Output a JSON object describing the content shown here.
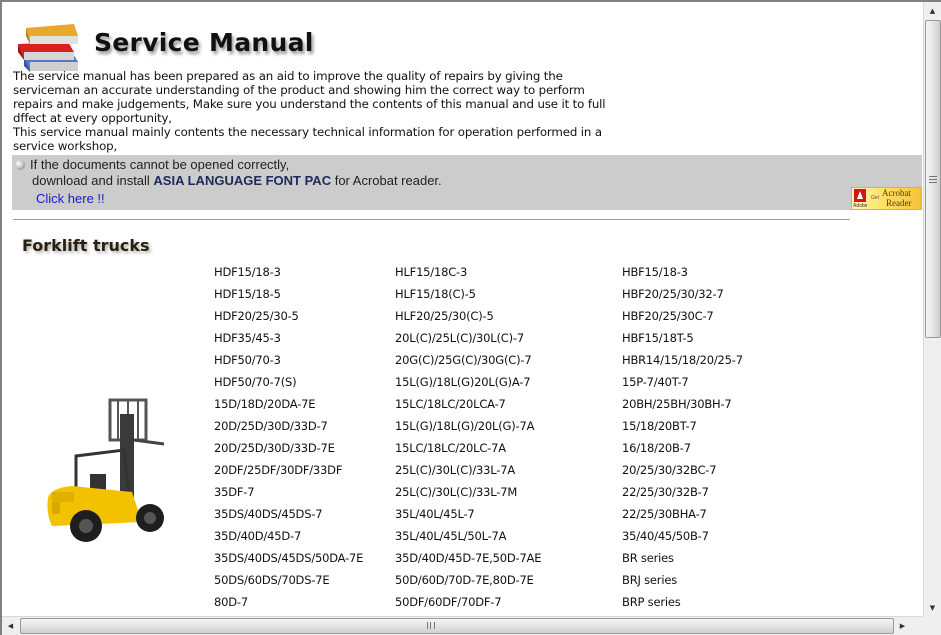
{
  "header": {
    "title": "Service Manual",
    "logo_icon": "books-icon"
  },
  "intro": {
    "paragraph1": "The service manual has been prepared as an aid to improve the quality of repairs by giving the serviceman an accurate understanding of the product and showing him the correct way to perform repairs and make judgements, Make sure you understand the contents of this manual and use it to full dffect at every opportunity,",
    "paragraph2": "This service manual mainly contents the necessary technical information for operation performed in a service workshop,"
  },
  "notice": {
    "line1": "If the documents cannot be opened correctly,",
    "line2_prefix": "download and install ",
    "line2_bold": "ASIA LANGUAGE FONT PAC",
    "line2_suffix": " for Acrobat reader.",
    "link": "Click here !!",
    "badge": {
      "adobe": "Adobe",
      "get": "Get",
      "acrobat": "Acrobat",
      "reader": "Reader"
    }
  },
  "section": {
    "title": "Forklift trucks",
    "image": "forklift-image"
  },
  "models": {
    "column1": [
      "HDF15/18-3",
      "HDF15/18-5",
      "HDF20/25/30-5",
      "HDF35/45-3",
      "HDF50/70-3",
      "HDF50/70-7(S)",
      "15D/18D/20DA-7E",
      "20D/25D/30D/33D-7",
      "20D/25D/30D/33D-7E",
      "20DF/25DF/30DF/33DF",
      "35DF-7",
      "35DS/40DS/45DS-7",
      "35D/40D/45D-7",
      "35DS/40DS/45DS/50DA-7E",
      "50DS/60DS/70DS-7E",
      "80D-7"
    ],
    "column2": [
      "HLF15/18C-3",
      "HLF15/18(C)-5",
      "HLF20/25/30(C)-5",
      "20L(C)/25L(C)/30L(C)-7",
      "20G(C)/25G(C)/30G(C)-7",
      "15L(G)/18L(G)20L(G)A-7",
      "15LC/18LC/20LCA-7",
      "15L(G)/18L(G)/20L(G)-7A",
      "15LC/18LC/20LC-7A",
      "25L(C)/30L(C)/33L-7A",
      "25L(C)/30L(C)/33L-7M",
      "35L/40L/45L-7",
      "35L/40L/45L/50L-7A",
      "35D/40D/45D-7E,50D-7AE",
      "50D/60D/70D-7E,80D-7E",
      "50DF/60DF/70DF-7"
    ],
    "column3": [
      "HBF15/18-3",
      "HBF20/25/30/32-7",
      "HBF20/25/30C-7",
      "HBF15/18T-5",
      "HBR14/15/18/20/25-7",
      "15P-7/40T-7",
      "20BH/25BH/30BH-7",
      "15/18/20BT-7",
      "16/18/20B-7",
      "20/25/30/32BC-7",
      "22/25/30/32B-7",
      "22/25/30BHA-7",
      "35/40/45/50B-7",
      "BR series",
      "BRJ series",
      "BRP series"
    ]
  },
  "scrollbars": {
    "vertical": {
      "up": "▲",
      "down": "▼",
      "position": 0.0
    },
    "horizontal": {
      "left": "◀",
      "right": "▶",
      "position": 0.0
    }
  },
  "colors": {
    "notice_bg": "#cccccc",
    "link": "#1a1acc",
    "bold_text": "#1c2a5c"
  }
}
